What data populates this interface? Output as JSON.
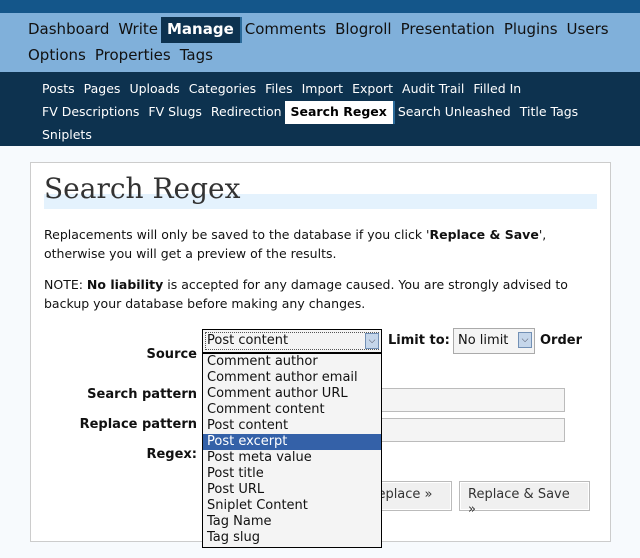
{
  "main_nav": {
    "items": [
      "Dashboard",
      "Write",
      "Manage",
      "Comments",
      "Blogroll",
      "Presentation",
      "Plugins",
      "Users",
      "Options",
      "Properties",
      "Tags"
    ],
    "active": "Manage"
  },
  "sub_nav": {
    "items": [
      "Posts",
      "Pages",
      "Uploads",
      "Categories",
      "Files",
      "Import",
      "Export",
      "Audit Trail",
      "Filled In",
      "FV Descriptions",
      "FV Slugs",
      "Redirection",
      "Search Regex",
      "Search Unleashed",
      "Title Tags",
      "Sniplets"
    ],
    "active": "Search Regex"
  },
  "page": {
    "title": "Search Regex",
    "intro_pre": "Replacements will only be saved to the database if you click '",
    "intro_bold": "Replace & Save",
    "intro_post": "', otherwise you will get a preview of the results.",
    "note_pre": "NOTE: ",
    "note_bold": "No liability",
    "note_post": " is accepted for any damage caused. You are strongly advised to backup your database before making any changes."
  },
  "form": {
    "source_label": "Source",
    "source_value": "Post content",
    "limit_label": "Limit to:",
    "limit_value": "No limit",
    "order_label": "Order",
    "search_label": "Search pattern",
    "search_value": "",
    "replace_label": "Replace pattern",
    "replace_value": "",
    "regex_label": "Regex:",
    "replace_button": "Replace »",
    "replace_save_button": "Replace & Save »",
    "source_options": [
      "Comment author",
      "Comment author email",
      "Comment author URL",
      "Comment content",
      "Post content",
      "Post excerpt",
      "Post meta value",
      "Post title",
      "Post URL",
      "Sniplet Content",
      "Tag Name",
      "Tag slug"
    ],
    "highlighted_option": "Post excerpt"
  },
  "colors": {
    "top_bar": "#14568a",
    "main_nav": "#80b0da",
    "sub_nav": "#0d324f",
    "highlight": "#3461a8"
  }
}
